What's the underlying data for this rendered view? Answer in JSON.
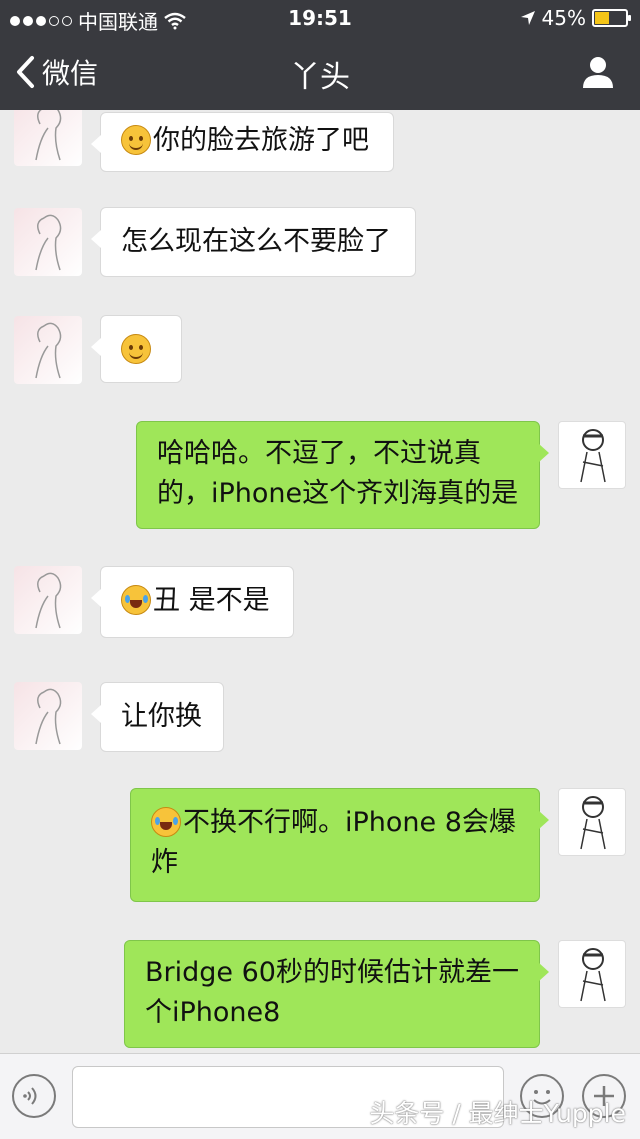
{
  "status_bar": {
    "carrier": "中国联通",
    "time": "19:51",
    "battery": "45%",
    "battery_level": 0.45
  },
  "nav": {
    "back_label": "微信",
    "title": "丫头"
  },
  "colors": {
    "nav_bg": "#393a3f",
    "chat_bg": "#ebebeb",
    "sent_bubble": "#9fe659",
    "received_bubble": "#ffffff"
  },
  "messages": [
    {
      "side": "left",
      "emoji": "smile",
      "text": "你的脸去旅游了吧"
    },
    {
      "side": "left",
      "emoji": "",
      "text": "怎么现在这么不要脸了"
    },
    {
      "side": "left",
      "emoji": "smile",
      "text": ""
    },
    {
      "side": "right",
      "emoji": "",
      "line1": "哈哈哈。不逗了，不过说真",
      "line2": "的，iPhone这个齐刘海真的是"
    },
    {
      "side": "left",
      "emoji": "tears-of-joy",
      "text": "丑 是不是"
    },
    {
      "side": "left",
      "emoji": "",
      "text": "让你换"
    },
    {
      "side": "right",
      "emoji": "tears-of-joy",
      "line1": "不换不行啊。iPhone 8会爆",
      "line2": "炸"
    },
    {
      "side": "right",
      "emoji": "",
      "line1": "Bridge 60秒的时候估计就差一",
      "line2": "个iPhone8"
    }
  ],
  "watermark": "头条号 / 最绅士Yupple"
}
